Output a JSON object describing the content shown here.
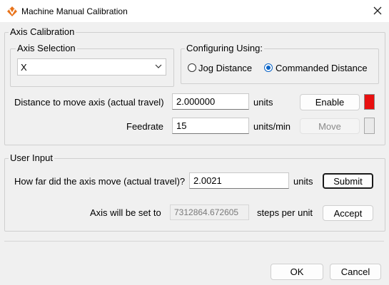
{
  "window": {
    "title": "Machine Manual Calibration"
  },
  "axis_calibration": {
    "title": "Axis Calibration",
    "axis_selection": {
      "title": "Axis Selection",
      "value": "X"
    },
    "configuring": {
      "title": "Configuring Using:",
      "jog_label": "Jog Distance",
      "commanded_label": "Commanded Distance",
      "selected": "Commanded Distance"
    },
    "distance": {
      "label": "Distance to move axis (actual travel)",
      "value": "2.000000",
      "unit": "units"
    },
    "feedrate": {
      "label": "Feedrate",
      "value": "15",
      "unit": "units/min"
    },
    "enable_label": "Enable",
    "move_label": "Move",
    "enable_indicator_color": "#e81010",
    "move_indicator_color": "#eaeaea"
  },
  "user_input": {
    "title": "User Input",
    "moved": {
      "label": "How far did the axis move (actual travel)?",
      "value": "2.0021",
      "unit": "units"
    },
    "submit_label": "Submit",
    "set_to": {
      "label": "Axis will be set to",
      "value": "7312864.672605",
      "unit": "steps per unit"
    },
    "accept_label": "Accept"
  },
  "footer": {
    "ok_label": "OK",
    "cancel_label": "Cancel"
  }
}
